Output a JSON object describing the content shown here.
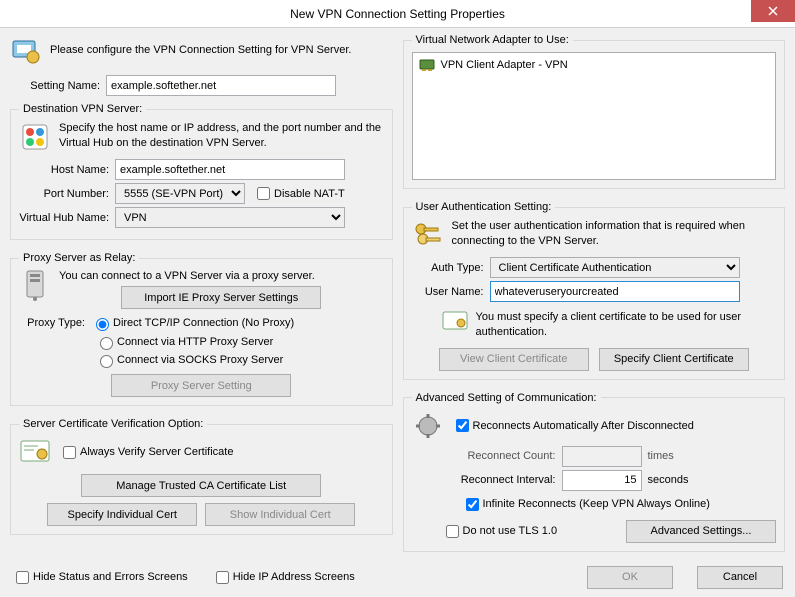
{
  "titlebar": {
    "title": "New VPN Connection Setting Properties"
  },
  "intro": "Please configure the VPN Connection Setting for VPN Server.",
  "setting_name": {
    "label": "Setting Name:",
    "value": "example.softether.net"
  },
  "dest": {
    "legend": "Destination VPN Server:",
    "desc": "Specify the host name or IP address, and the port number and the Virtual Hub on the destination VPN Server.",
    "host_label": "Host Name:",
    "host_value": "example.softether.net",
    "port_label": "Port Number:",
    "port_value": "5555 (SE-VPN Port)",
    "disable_natt": "Disable NAT-T",
    "hub_label": "Virtual Hub Name:",
    "hub_value": "VPN"
  },
  "proxy": {
    "legend": "Proxy Server as Relay:",
    "desc": "You can connect to a VPN Server via a proxy server.",
    "import_btn": "Import IE Proxy Server Settings",
    "type_label": "Proxy Type:",
    "r1": "Direct TCP/IP Connection (No Proxy)",
    "r2": "Connect via HTTP Proxy Server",
    "r3": "Connect via SOCKS Proxy Server",
    "setting_btn": "Proxy Server Setting"
  },
  "cert": {
    "legend": "Server Certificate Verification Option:",
    "always": "Always Verify Server Certificate",
    "manage_btn": "Manage Trusted CA Certificate List",
    "spec_btn": "Specify Individual Cert",
    "show_btn": "Show Individual Cert"
  },
  "adapter": {
    "legend": "Virtual Network Adapter to Use:",
    "item": "VPN Client Adapter - VPN"
  },
  "auth": {
    "legend": "User Authentication Setting:",
    "desc": "Set the user authentication information that is required when connecting to the VPN Server.",
    "type_label": "Auth Type:",
    "type_value": "Client Certificate Authentication",
    "user_label": "User Name:",
    "user_value": "whateveruseryourcreated",
    "must": "You must specify a client certificate to be used for user authentication.",
    "view_btn": "View Client Certificate",
    "spec_btn": "Specify Client Certificate"
  },
  "adv": {
    "legend": "Advanced Setting of Communication:",
    "reconnect": "Reconnects Automatically After Disconnected",
    "count_label": "Reconnect Count:",
    "count_unit": "times",
    "interval_label": "Reconnect Interval:",
    "interval_value": "15",
    "interval_unit": "seconds",
    "infinite": "Infinite Reconnects (Keep VPN Always Online)",
    "no_tls": "Do not use TLS 1.0",
    "adv_btn": "Advanced Settings..."
  },
  "bottom": {
    "hide_status": "Hide Status and Errors Screens",
    "hide_ip": "Hide IP Address Screens",
    "ok": "OK",
    "cancel": "Cancel"
  }
}
